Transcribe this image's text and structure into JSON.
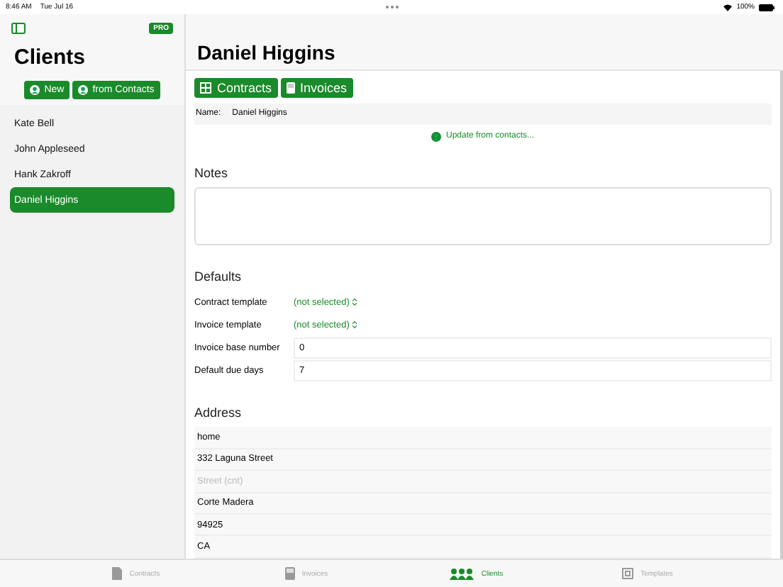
{
  "status_bar": {
    "time": "8:46 AM",
    "date": "Tue Jul 16",
    "battery": "100%"
  },
  "sidebar": {
    "badge": "PRO",
    "title": "Clients",
    "buttons": [
      "New",
      "from Contacts"
    ],
    "items": [
      {
        "label": "Kate Bell",
        "selected": false
      },
      {
        "label": "John Appleseed",
        "selected": false
      },
      {
        "label": "Hank Zakroff",
        "selected": false
      },
      {
        "label": "Daniel Higgins",
        "selected": true
      }
    ]
  },
  "detail": {
    "title": "Daniel Higgins",
    "buttons": [
      {
        "kind": "grid",
        "label": "Contracts"
      },
      {
        "kind": "book",
        "label": "Invoices"
      }
    ],
    "name_label": "Name:",
    "name_value": "Daniel Higgins",
    "update_link": "Update from contacts...",
    "notes_heading": "Notes",
    "defaults_heading": "Defaults",
    "defaults": [
      {
        "kind": "picker",
        "label": "Contract template",
        "value": "(not selected)"
      },
      {
        "kind": "picker",
        "label": "Invoice template",
        "value": "(not selected)"
      },
      {
        "kind": "field",
        "label": "Invoice base number",
        "value": "0"
      },
      {
        "kind": "field",
        "label": "Default due days",
        "value": "7"
      }
    ],
    "address_heading": "Address",
    "address": [
      {
        "value": "home"
      },
      {
        "value": "332 Laguna Street"
      },
      {
        "placeholder": "Street (cnt)"
      },
      {
        "value": "Corte Madera"
      },
      {
        "value": "94925"
      },
      {
        "value": "CA"
      }
    ]
  },
  "tab_bar": [
    {
      "kind": "doc",
      "label": "Contracts",
      "selected": false
    },
    {
      "kind": "book",
      "label": "Invoices",
      "selected": false
    },
    {
      "kind": "people",
      "label": "Clients",
      "selected": true
    },
    {
      "kind": "frame",
      "label": "Templates",
      "selected": false
    }
  ]
}
